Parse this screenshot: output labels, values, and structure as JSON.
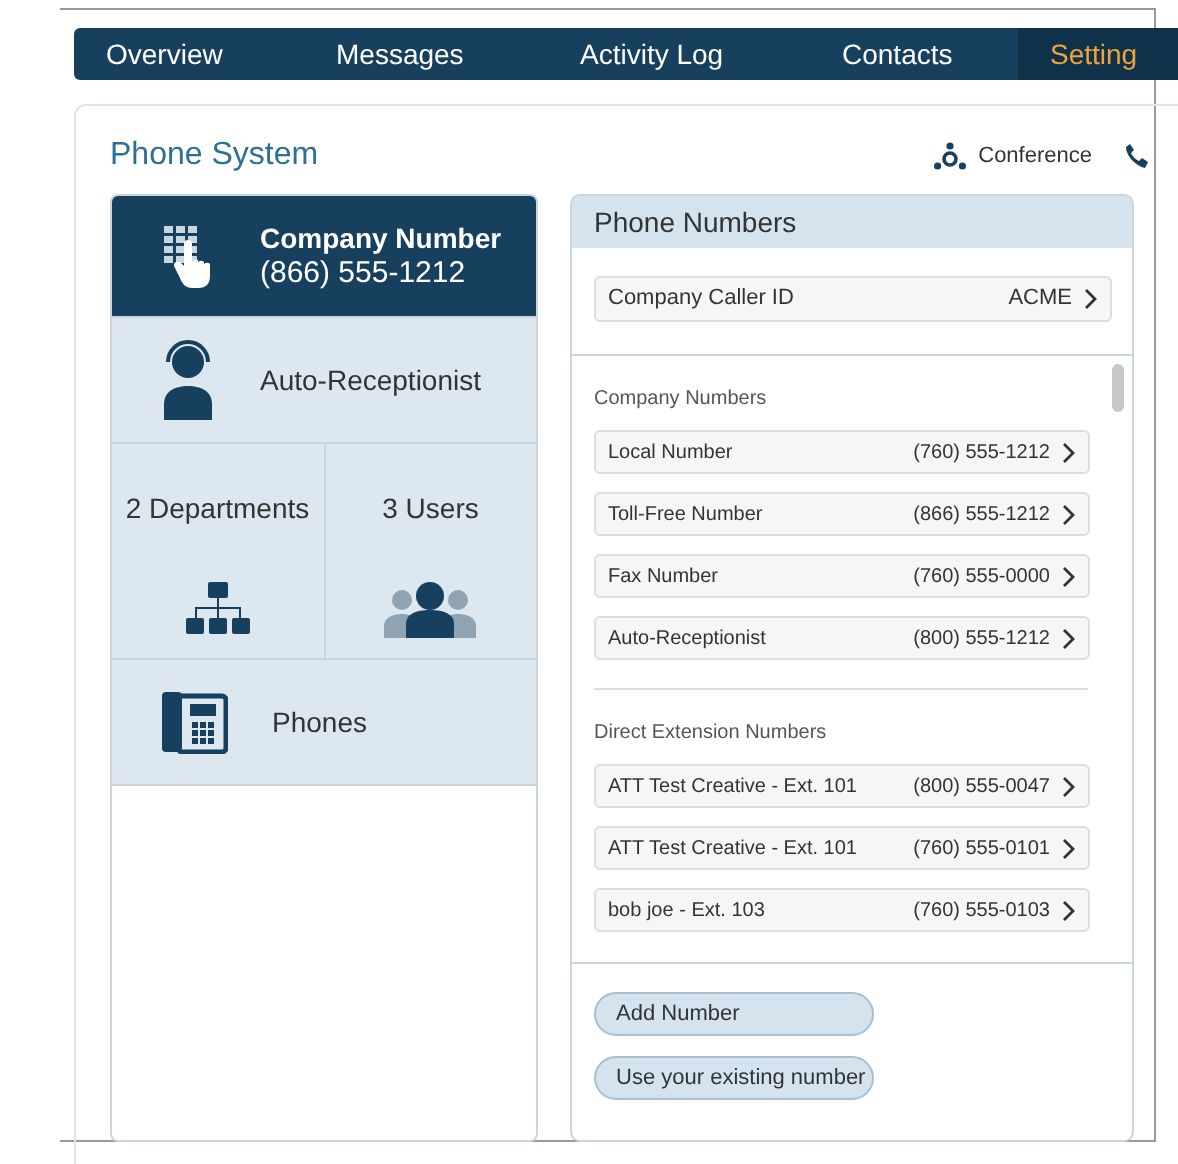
{
  "nav": {
    "tabs": [
      {
        "label": "Overview",
        "selected": false
      },
      {
        "label": "Messages",
        "selected": false
      },
      {
        "label": "Activity Log",
        "selected": false
      },
      {
        "label": "Contacts",
        "selected": false
      },
      {
        "label": "Setting",
        "selected": true
      }
    ]
  },
  "page_title": "Phone System",
  "header_actions": [
    {
      "label": "Conference"
    }
  ],
  "menu": [
    {
      "kind": "number",
      "title": "Company Number",
      "number": "(866) 555-1212",
      "selected": true
    },
    {
      "kind": "row",
      "label": "Auto-Receptionist",
      "selected": false
    },
    {
      "kind": "pair",
      "cells": [
        {
          "label": "2 Departments"
        },
        {
          "label": "3 Users"
        }
      ]
    },
    {
      "kind": "row",
      "label": "Phones",
      "selected": false
    }
  ],
  "phone_numbers": {
    "title": "Phone Numbers",
    "caller_id": {
      "label": "Company Caller ID",
      "value": "ACME"
    },
    "sections": [
      {
        "heading": "Company Numbers",
        "rows": [
          {
            "label": "Local Number",
            "number": "(760) 555-1212"
          },
          {
            "label": "Toll-Free Number",
            "number": "(866) 555-1212"
          },
          {
            "label": "Fax Number",
            "number": "(760) 555-0000"
          },
          {
            "label": "Auto-Receptionist",
            "number": "(800) 555-1212"
          }
        ]
      },
      {
        "heading": "Direct Extension Numbers",
        "rows": [
          {
            "label": "ATT Test Creative - Ext. 101",
            "number": "(800) 555-0047"
          },
          {
            "label": "ATT Test Creative - Ext. 101",
            "number": "(760) 555-0101"
          },
          {
            "label": "bob joe - Ext. 103",
            "number": "(760) 555-0103"
          }
        ]
      }
    ],
    "buttons": [
      "Add Number",
      "Use your existing number"
    ]
  }
}
